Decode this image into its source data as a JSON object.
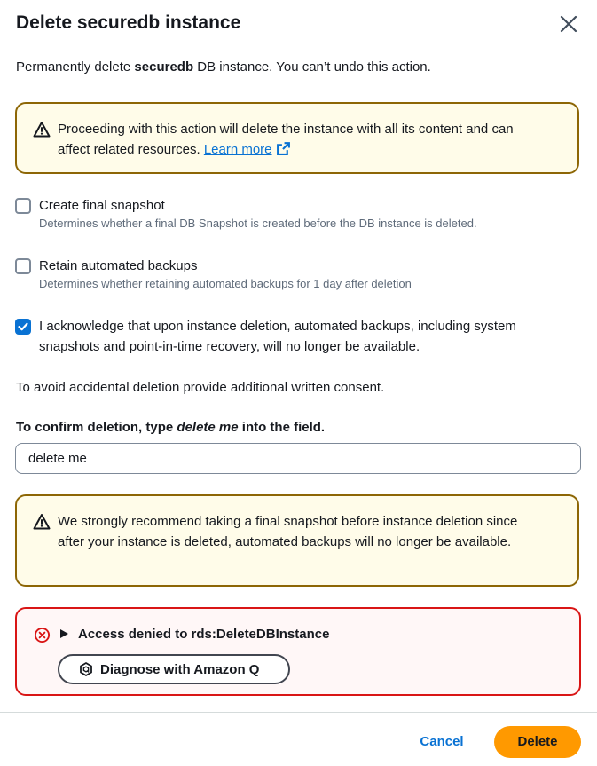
{
  "modal": {
    "title": "Delete securedb instance",
    "intro_prefix": "Permanently delete ",
    "intro_bold": "securedb",
    "intro_suffix": " DB instance. You can’t undo this action."
  },
  "warning1": {
    "text": "Proceeding with this action will delete the instance with all its content and can affect related resources. ",
    "link": "Learn more",
    "icon": "warning-icon",
    "link_icon": "external-link-icon"
  },
  "options": [
    {
      "label": "Create final snapshot",
      "description": "Determines whether a final DB Snapshot is created before the DB instance is deleted.",
      "checked": false
    },
    {
      "label": "Retain automated backups",
      "description": "Determines whether retaining automated backups for 1 day after deletion",
      "checked": false
    },
    {
      "label": "I acknowledge that upon instance deletion, automated backups, including system snapshots and point-in-time recovery, will no longer be available.",
      "checked": true
    }
  ],
  "consent_text": "To avoid accidental deletion provide additional written consent.",
  "confirm": {
    "label_prefix": "To confirm deletion, type ",
    "label_italic": "delete me",
    "label_suffix": " into the field.",
    "value": "delete me"
  },
  "warning2": {
    "text": "We strongly recommend taking a final snapshot before instance deletion since after your instance is deleted, automated backups will no longer be available."
  },
  "error": {
    "title": "Access denied to rds:DeleteDBInstance",
    "button": "Diagnose with Amazon Q",
    "icon": "error-icon"
  },
  "footer": {
    "cancel": "Cancel",
    "delete": "Delete"
  },
  "colors": {
    "primary": "#ff9900",
    "link": "#0972d3",
    "warning_border": "#8d6605",
    "error_border": "#d91515"
  }
}
